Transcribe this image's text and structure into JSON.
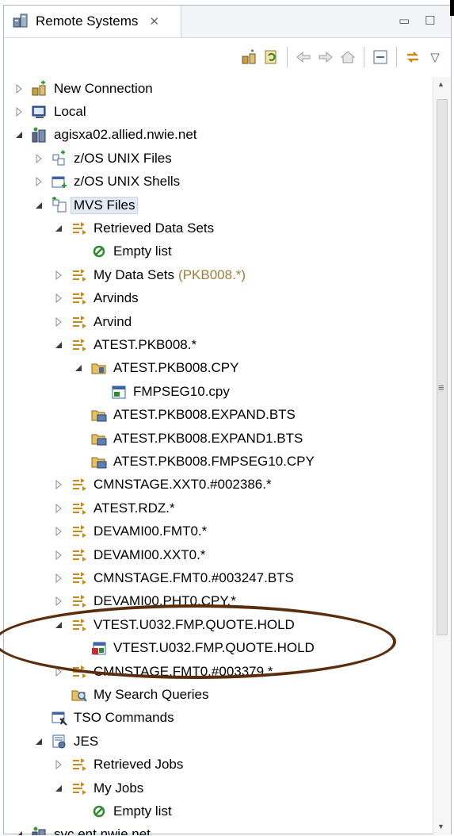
{
  "view": {
    "title": "Remote Systems",
    "close_glyph": "✕",
    "minimize_glyph": "▭",
    "maximize_glyph": "☐",
    "menu_glyph": "▽"
  },
  "toolbar": {
    "icons": [
      "define-connection-icon",
      "refresh-icon",
      "back-icon",
      "forward-icon",
      "home-icon",
      "collapse-all-icon",
      "link-with-editor-icon"
    ]
  },
  "tree": [
    {
      "depth": 0,
      "twisty": "collapsed",
      "icon": "new-connection-icon",
      "label": "New Connection"
    },
    {
      "depth": 0,
      "twisty": "collapsed",
      "icon": "local-icon",
      "label": "Local"
    },
    {
      "depth": 0,
      "twisty": "expanded",
      "icon": "remote-host-icon",
      "label": "agisxa02.allied.nwie.net"
    },
    {
      "depth": 1,
      "twisty": "collapsed",
      "icon": "unix-files-icon",
      "label": "z/OS UNIX Files"
    },
    {
      "depth": 1,
      "twisty": "collapsed",
      "icon": "unix-shells-icon",
      "label": "z/OS UNIX Shells"
    },
    {
      "depth": 1,
      "twisty": "expanded",
      "icon": "mvs-files-icon",
      "label": "MVS Files",
      "selected": true
    },
    {
      "depth": 2,
      "twisty": "expanded",
      "icon": "filter-icon",
      "label": "Retrieved Data Sets"
    },
    {
      "depth": 3,
      "twisty": "none",
      "icon": "empty-icon",
      "label": "Empty list"
    },
    {
      "depth": 2,
      "twisty": "collapsed",
      "icon": "filter-icon",
      "label": "My Data Sets",
      "suffix": "(PKB008.*)"
    },
    {
      "depth": 2,
      "twisty": "collapsed",
      "icon": "filter-icon",
      "label": "Arvinds"
    },
    {
      "depth": 2,
      "twisty": "collapsed",
      "icon": "filter-icon",
      "label": "Arvind"
    },
    {
      "depth": 2,
      "twisty": "expanded",
      "icon": "filter-icon",
      "label": "ATEST.PKB008.*"
    },
    {
      "depth": 3,
      "twisty": "expanded",
      "icon": "pds-icon",
      "label": "ATEST.PKB008.CPY"
    },
    {
      "depth": 4,
      "twisty": "none",
      "icon": "member-icon",
      "label": "FMPSEG10.cpy"
    },
    {
      "depth": 3,
      "twisty": "none",
      "icon": "dataset-icon",
      "label": "ATEST.PKB008.EXPAND.BTS"
    },
    {
      "depth": 3,
      "twisty": "none",
      "icon": "dataset-icon",
      "label": "ATEST.PKB008.EXPAND1.BTS"
    },
    {
      "depth": 3,
      "twisty": "none",
      "icon": "dataset-icon",
      "label": "ATEST.PKB008.FMPSEG10.CPY"
    },
    {
      "depth": 2,
      "twisty": "collapsed",
      "icon": "filter-icon",
      "label": "CMNSTAGE.XXT0.#002386.*"
    },
    {
      "depth": 2,
      "twisty": "collapsed",
      "icon": "filter-icon",
      "label": "ATEST.RDZ.*"
    },
    {
      "depth": 2,
      "twisty": "collapsed",
      "icon": "filter-icon",
      "label": "DEVAMI00.FMT0.*"
    },
    {
      "depth": 2,
      "twisty": "collapsed",
      "icon": "filter-icon",
      "label": "DEVAMI00.XXT0.*"
    },
    {
      "depth": 2,
      "twisty": "collapsed",
      "icon": "filter-icon",
      "label": "CMNSTAGE.FMT0.#003247.BTS"
    },
    {
      "depth": 2,
      "twisty": "collapsed",
      "icon": "filter-icon",
      "label": "DEVAMI00.PHT0.CPY.*"
    },
    {
      "depth": 2,
      "twisty": "expanded",
      "icon": "filter-icon",
      "label": "VTEST.U032.FMP.QUOTE.HOLD"
    },
    {
      "depth": 3,
      "twisty": "none",
      "icon": "migrated-dataset-icon",
      "label": "VTEST.U032.FMP.QUOTE.HOLD"
    },
    {
      "depth": 2,
      "twisty": "collapsed",
      "icon": "filter-icon",
      "label": "CMNSTAGE.FMT0.#003379.*"
    },
    {
      "depth": 2,
      "twisty": "none",
      "icon": "search-queries-icon",
      "label": "My Search Queries"
    },
    {
      "depth": 1,
      "twisty": "none",
      "icon": "tso-commands-icon",
      "label": "TSO Commands"
    },
    {
      "depth": 1,
      "twisty": "expanded",
      "icon": "jes-icon",
      "label": "JES"
    },
    {
      "depth": 2,
      "twisty": "collapsed",
      "icon": "filter-icon",
      "label": "Retrieved Jobs"
    },
    {
      "depth": 2,
      "twisty": "expanded",
      "icon": "filter-icon",
      "label": "My Jobs"
    },
    {
      "depth": 3,
      "twisty": "none",
      "icon": "empty-icon",
      "label": "Empty list"
    },
    {
      "depth": 0,
      "twisty": "expanded",
      "icon": "remote-host-icon",
      "label": "syc.ent.nwie.net"
    }
  ],
  "scrollbar": {
    "up_glyph": "▲",
    "down_glyph": "▼",
    "grip_glyph": "≡"
  },
  "colors": {
    "accent": "#1f5fbf",
    "annotation": "#5a2d0c",
    "suffix": "#a07c3a"
  }
}
